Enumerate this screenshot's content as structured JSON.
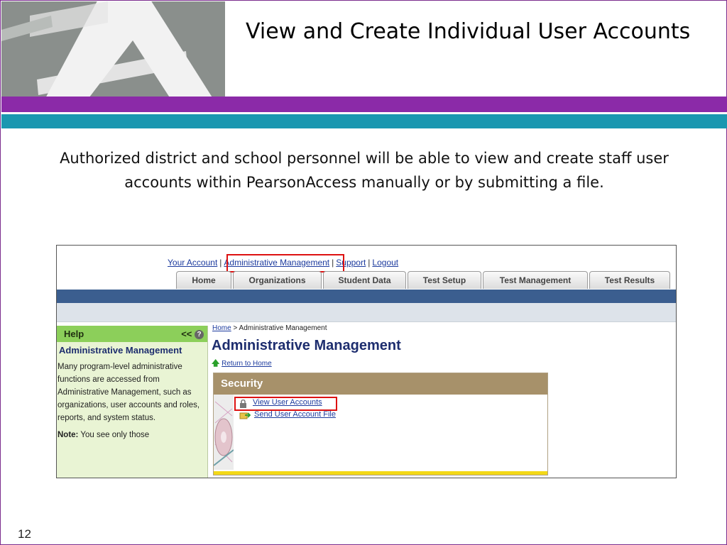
{
  "slide": {
    "title": "View and Create Individual User Accounts",
    "body": "Authorized district and school personnel will be able to view and create staff user accounts within PearsonAccess manually or by submitting a file.",
    "page_number": "12",
    "colors": {
      "purple_band": "#8b2aa8",
      "teal_band": "#1a97b0",
      "logo_bg": "#8a8f8c"
    }
  },
  "screenshot": {
    "top_links": {
      "your_account": "Your Account",
      "admin": "Administrative Management",
      "support": "Support",
      "logout": "Logout"
    },
    "tabs": [
      "Home",
      "Organizations",
      "Student Data",
      "Test Setup",
      "Test Management",
      "Test Results"
    ],
    "help": {
      "header": "Help",
      "collapse": "<<",
      "title": "Administrative Management",
      "body": "Many program-level administrative functions are accessed from Administrative Management, such as organizations, user accounts and roles, reports, and system status.",
      "note_label": "Note:",
      "note_text": "You see only those"
    },
    "breadcrumb": {
      "home": "Home",
      "sep": ">",
      "current": "Administrative Management"
    },
    "page_title": "Administrative Management",
    "return_link": "Return to Home",
    "security": {
      "header": "Security",
      "view_users": "View User Accounts",
      "send_file": "Send User Account File"
    },
    "icons": [
      "question-icon",
      "up-arrow-icon",
      "lock-icon",
      "send-file-icon"
    ]
  }
}
